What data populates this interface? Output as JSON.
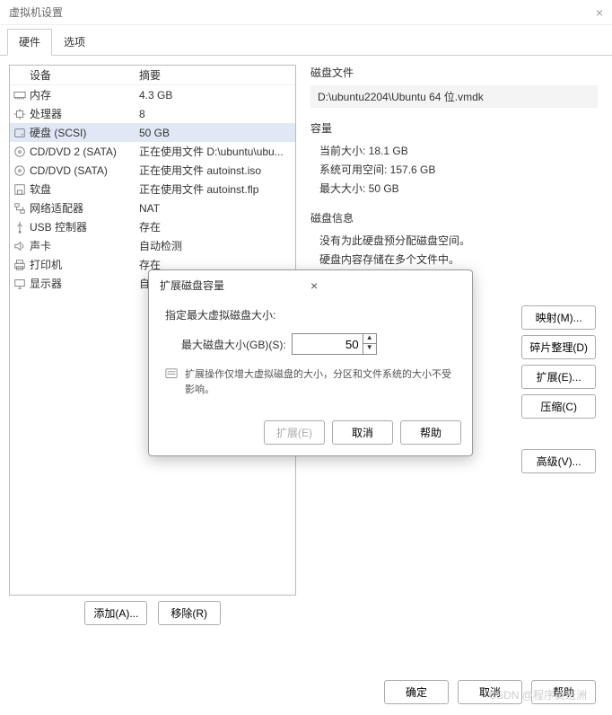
{
  "window": {
    "title": "虚拟机设置",
    "close_icon": "×"
  },
  "tabs": {
    "hardware": "硬件",
    "options": "选项"
  },
  "device_headers": {
    "device": "设备",
    "summary": "摘要"
  },
  "devices": [
    {
      "icon": "memory",
      "name": "内存",
      "summary": "4.3 GB",
      "selected": false
    },
    {
      "icon": "cpu",
      "name": "处理器",
      "summary": "8",
      "selected": false
    },
    {
      "icon": "disk",
      "name": "硬盘 (SCSI)",
      "summary": "50 GB",
      "selected": true
    },
    {
      "icon": "cd",
      "name": "CD/DVD 2 (SATA)",
      "summary": "正在使用文件 D:\\ubuntu\\ubu...",
      "selected": false
    },
    {
      "icon": "cd",
      "name": "CD/DVD (SATA)",
      "summary": "正在使用文件 autoinst.iso",
      "selected": false
    },
    {
      "icon": "floppy",
      "name": "软盘",
      "summary": "正在使用文件 autoinst.flp",
      "selected": false
    },
    {
      "icon": "network",
      "name": "网络适配器",
      "summary": "NAT",
      "selected": false
    },
    {
      "icon": "usb",
      "name": "USB 控制器",
      "summary": "存在",
      "selected": false
    },
    {
      "icon": "sound",
      "name": "声卡",
      "summary": "自动检测",
      "selected": false
    },
    {
      "icon": "printer",
      "name": "打印机",
      "summary": "存在",
      "selected": false
    },
    {
      "icon": "display",
      "name": "显示器",
      "summary": "自动检测",
      "selected": false
    }
  ],
  "device_buttons": {
    "add": "添加(A)...",
    "remove": "移除(R)"
  },
  "right": {
    "disk_file_label": "磁盘文件",
    "disk_file": "D:\\ubuntu2204\\Ubuntu 64 位.vmdk",
    "capacity_label": "容量",
    "current_size": "当前大小: 18.1 GB",
    "free_space": "系统可用空间: 157.6 GB",
    "max_size": "最大大小: 50 GB",
    "disk_info_label": "磁盘信息",
    "info_1": "没有为此硬盘预分配磁盘空间。",
    "info_2": "硬盘内容存储在多个文件中。"
  },
  "right_buttons": {
    "map": "映射(M)...",
    "defrag": "碎片整理(D)",
    "expand": "扩展(E)...",
    "compact": "压缩(C)",
    "advanced": "高级(V)..."
  },
  "footer": {
    "ok": "确定",
    "cancel": "取消",
    "help": "帮助"
  },
  "modal": {
    "title": "扩展磁盘容量",
    "label": "指定最大虚拟磁盘大小:",
    "field_label": "最大磁盘大小(GB)(S):",
    "value": "50",
    "note": "扩展操作仅增大虚拟磁盘的大小，分区和文件系统的大小不受影响。",
    "expand_btn": "扩展(E)",
    "cancel_btn": "取消",
    "help_btn": "帮助",
    "close": "×"
  },
  "watermark": "CSDN @程序员班洲"
}
